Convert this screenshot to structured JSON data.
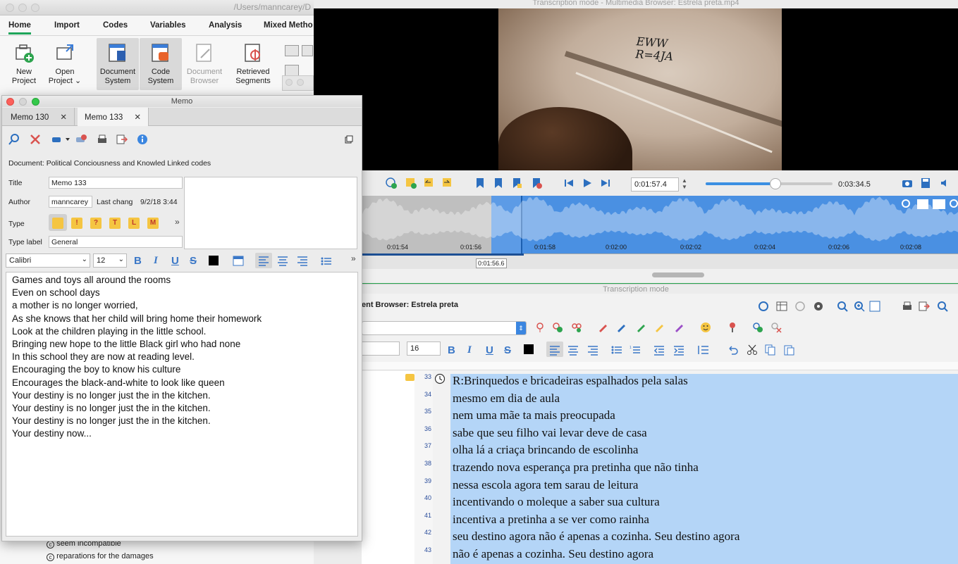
{
  "main": {
    "path": "/Users/manncarey/D",
    "tabs": [
      "Home",
      "Import",
      "Codes",
      "Variables",
      "Analysis",
      "Mixed Metho"
    ],
    "ribbon": [
      {
        "label1": "New",
        "label2": "Project"
      },
      {
        "label1": "Open",
        "label2": "Project ⌄"
      },
      {
        "label1": "Document",
        "label2": "System"
      },
      {
        "label1": "Code",
        "label2": "System"
      },
      {
        "label1": "Document",
        "label2": "Browser"
      },
      {
        "label1": "Retrieved",
        "label2": "Segments"
      }
    ],
    "codes": [
      "seem incompatible",
      "reparations for the damages"
    ]
  },
  "media": {
    "title": "Transcription mode - Multimedia Browser:  Estrela preta.mp4",
    "writing": [
      "EWW",
      "R=4JA"
    ],
    "current_time": "0:01:57.4",
    "total_time": "0:03:34.5",
    "position_fraction": 0.55,
    "cursor_time": "0:01:56.6",
    "ticks": [
      "0:01:54",
      "0:01:56",
      "0:01:58",
      "0:02:00",
      "0:02:02",
      "0:02:04",
      "0:02:06",
      "0:02:08"
    ]
  },
  "mode_label": "Transcription mode",
  "doc_browser": {
    "title": "ent Browser: Estrela preta",
    "font_size": "16",
    "line_numbers": [
      "33",
      "34",
      "35",
      "36",
      "37",
      "38",
      "39",
      "40",
      "41",
      "42",
      "43"
    ],
    "lines": [
      "R:Brinquedos e bricadeiras espalhados pela salas",
      "mesmo em dia de aula",
      "nem uma mãe ta mais preocupada",
      "sabe que seu filho vai levar deve de casa",
      "olha lá a criaça brincando de escolinha",
      "trazendo nova esperança pra pretinha que não tinha",
      "nessa escola agora tem sarau de leitura",
      "incentivando o moleque a saber sua cultura",
      "incentiva a pretinha a se ver como rainha",
      "seu destino agora não é apenas a cozinha. Seu destino agora",
      " não é apenas a cozinha. Seu destino agora"
    ]
  },
  "memo": {
    "window_title": "Memo",
    "tabs": [
      "Memo 130",
      "Memo 133"
    ],
    "document": "Document: Political Conciousness and Knowled Linked codes",
    "title_label": "Title",
    "title_value": "Memo 133",
    "author_label": "Author",
    "author_value": "manncarey",
    "last_changed_label": "Last chang",
    "last_changed_value": "9/2/18 3:44",
    "type_label": "Type",
    "type_icons": [
      "",
      "!",
      "?",
      "T",
      "L",
      "M"
    ],
    "typelabel_label": "Type label",
    "typelabel_value": "General",
    "font": "Calibri",
    "font_size": "12",
    "lines": [
      "Games and toys all around the rooms",
      "Even on school days",
      "a mother is no longer worried,",
      "As she knows that her child will bring home their homework",
      "Look at the children playing in the little school.",
      "Bringing new hope to the little Black girl who had none",
      "In this school they are now at reading level.",
      "Encouraging the boy to know his culture",
      "Encourages the black-and-white to look like queen",
      "Your destiny is no longer just the in the kitchen.",
      "Your destiny is no longer just the in the kitchen.",
      "Your destiny is no longer just the in the kitchen.",
      "Your destiny now..."
    ]
  },
  "colors": {
    "accent_green": "#27a54e",
    "waveform_blue": "#4a90e2",
    "selection_blue": "#b4d5f7"
  }
}
